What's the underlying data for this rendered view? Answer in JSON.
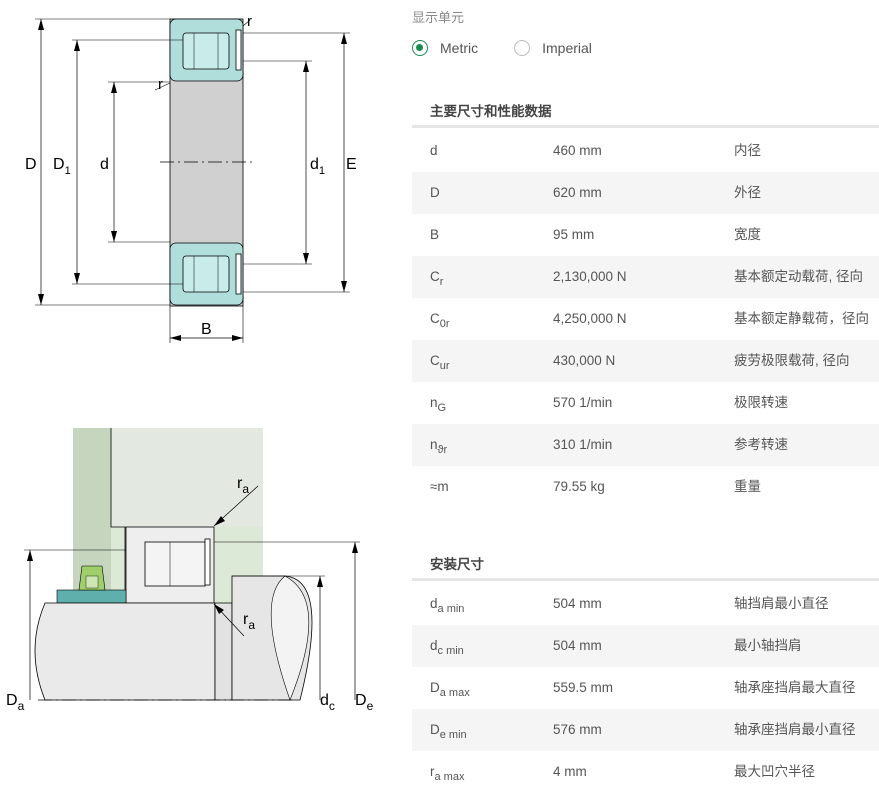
{
  "diagram_top": {
    "labels": {
      "D": "D",
      "D1": "D",
      "D1_sub": "1",
      "d": "d",
      "d1": "d",
      "d1_sub": "1",
      "E": "E",
      "B": "B",
      "r_top": "r",
      "r_mid": "r"
    },
    "colors": {
      "ring": "#d0d0d0",
      "teal": "#b0dedb",
      "line": "#000000"
    }
  },
  "diagram_bottom": {
    "labels": {
      "ra1": "r",
      "ra1_sub": "a",
      "ra2": "r",
      "ra2_sub": "a",
      "Da": "D",
      "Da_sub": "a",
      "dc": "d",
      "dc_sub": "c",
      "De": "D",
      "De_sub": "e"
    },
    "colors": {
      "green_light": "#dde9d7",
      "green_dark": "#c6d5bd",
      "housing": "#eaeaea",
      "teal": "#5fb0ad",
      "seal": "#9ecf6a"
    }
  },
  "unit_selector": {
    "label": "显示单元",
    "options": [
      {
        "label": "Metric",
        "selected": true
      },
      {
        "label": "Imperial",
        "selected": false
      }
    ]
  },
  "main_dims": {
    "title": "主要尺寸和性能数据",
    "rows": [
      {
        "sym": "d",
        "sub": "",
        "value": "460 mm",
        "desc": "内径"
      },
      {
        "sym": "D",
        "sub": "",
        "value": "620 mm",
        "desc": "外径"
      },
      {
        "sym": "B",
        "sub": "",
        "value": "95 mm",
        "desc": "宽度"
      },
      {
        "sym": "C",
        "sub": "r",
        "value": "2,130,000 N",
        "desc": "基本额定动载荷, 径向"
      },
      {
        "sym": "C",
        "sub": "0r",
        "value": "4,250,000 N",
        "desc": "基本额定静载荷，径向"
      },
      {
        "sym": "C",
        "sub": "ur",
        "value": "430,000 N",
        "desc": "疲劳极限载荷, 径向"
      },
      {
        "sym": "n",
        "sub": "G",
        "value": "570 1/min",
        "desc": "极限转速"
      },
      {
        "sym": "n",
        "sub": "ϑr",
        "value": "310 1/min",
        "desc": "参考转速"
      },
      {
        "sym": "≈m",
        "sub": "",
        "value": "79.55 kg",
        "desc": "重量"
      }
    ]
  },
  "mount_dims": {
    "title": "安装尺寸",
    "rows": [
      {
        "sym": "d",
        "sub": "a min",
        "value": "504 mm",
        "desc": "轴挡肩最小直径"
      },
      {
        "sym": "d",
        "sub": "c min",
        "value": "504 mm",
        "desc": "最小轴挡肩"
      },
      {
        "sym": "D",
        "sub": "a max",
        "value": "559.5 mm",
        "desc": "轴承座挡肩最大直径"
      },
      {
        "sym": "D",
        "sub": "e min",
        "value": "576 mm",
        "desc": "轴承座挡肩最小直径"
      },
      {
        "sym": "r",
        "sub": "a max",
        "value": "4 mm",
        "desc": "最大凹穴半径"
      }
    ]
  }
}
